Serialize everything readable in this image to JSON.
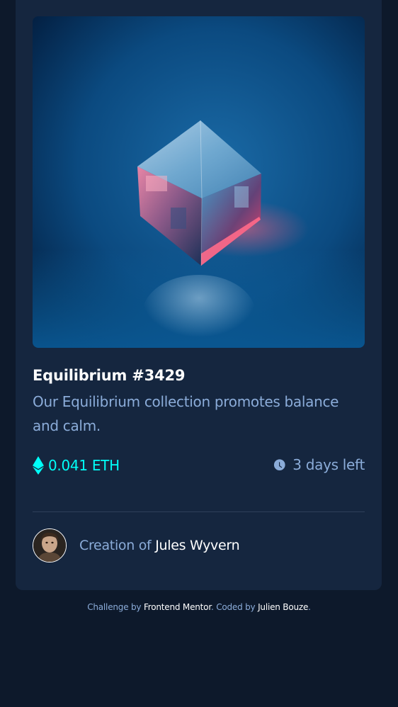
{
  "card": {
    "image_alt": "Equilibrium",
    "title": "Equilibrium #3429",
    "description": "Our Equilibrium collection promotes balance and calm.",
    "price": "0.041 ETH",
    "price_icon": "ethereum-icon",
    "time_left": "3 days left",
    "time_icon": "clock-icon",
    "creator_prefix": "Creation of",
    "creator_name": "Jules Wyvern"
  },
  "attribution": {
    "challenge_prefix": "Challenge by",
    "challenge_link": "Frontend Mentor",
    "separator": ". ",
    "coded_prefix": "Coded by",
    "coded_link": "Julien Bouze",
    "end": "."
  },
  "colors": {
    "background": "#0d192b",
    "card": "#15263f",
    "accent_cyan": "#00fff8",
    "soft_blue": "#8bacd9",
    "white": "#ffffff"
  }
}
